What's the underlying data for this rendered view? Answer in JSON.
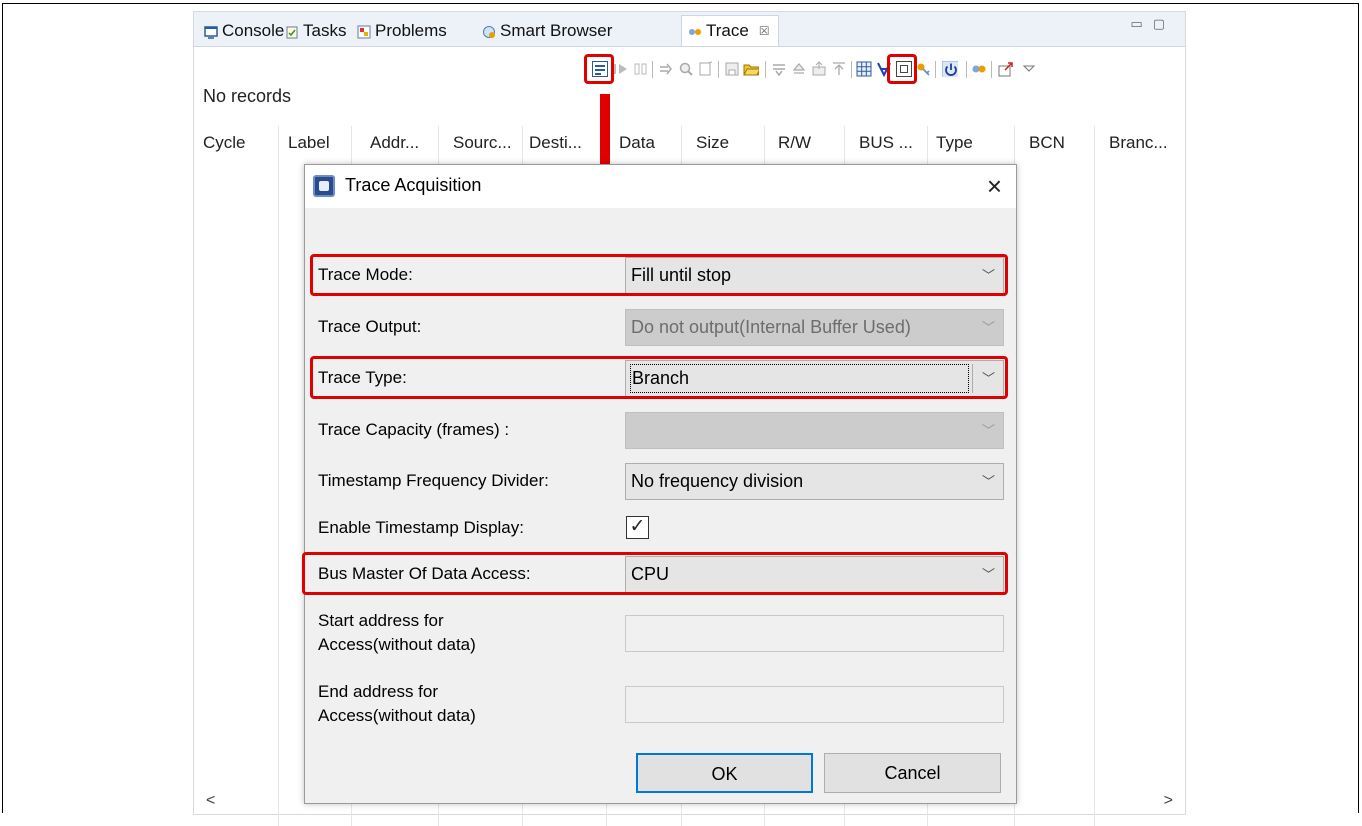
{
  "tabs": [
    {
      "label": "Console",
      "icon": "console-icon"
    },
    {
      "label": "Tasks",
      "icon": "tasks-icon"
    },
    {
      "label": "Problems",
      "icon": "problems-icon"
    },
    {
      "label": "Smart Browser",
      "icon": "smart-browser-icon"
    },
    {
      "label": "Trace",
      "icon": "trace-icon",
      "close": "☒"
    }
  ],
  "view_controls": {
    "minimize": "▭",
    "maximize": "▢"
  },
  "status": {
    "no_records": "No records"
  },
  "columns": [
    "Cycle",
    "Label",
    "Addr...",
    "Sourc...",
    "Desti...",
    "Data",
    "Size",
    "R/W",
    "BUS ...",
    "Type",
    "BCN",
    "Branc..."
  ],
  "scroll": {
    "left": "<",
    "right": ">"
  },
  "dialog": {
    "title": "Trace Acquisition",
    "close": "×",
    "fields": {
      "trace_mode": {
        "label": "Trace Mode:",
        "value": "Fill until stop"
      },
      "trace_output": {
        "label": "Trace Output:",
        "value": "Do not output(Internal Buffer Used)"
      },
      "trace_type": {
        "label": "Trace Type:",
        "value": "Branch"
      },
      "trace_capacity": {
        "label": "Trace Capacity (frames) :",
        "value": ""
      },
      "timestamp_divider": {
        "label": "Timestamp Frequency Divider:",
        "value": "No frequency division"
      },
      "enable_timestamp": {
        "label": "Enable Timestamp Display:",
        "checked": true,
        "mark": "✓"
      },
      "bus_master": {
        "label": "Bus Master Of Data Access:",
        "value": "CPU"
      },
      "start_address_1": "Start address for",
      "start_address_2": "Access(without data)",
      "end_address_1": "End address for",
      "end_address_2": "Access(without data)"
    },
    "ok": "OK",
    "cancel": "Cancel"
  },
  "colors": {
    "highlight": "#e00000",
    "focus": "#0078d7",
    "tabbar": "#edf1f8"
  }
}
